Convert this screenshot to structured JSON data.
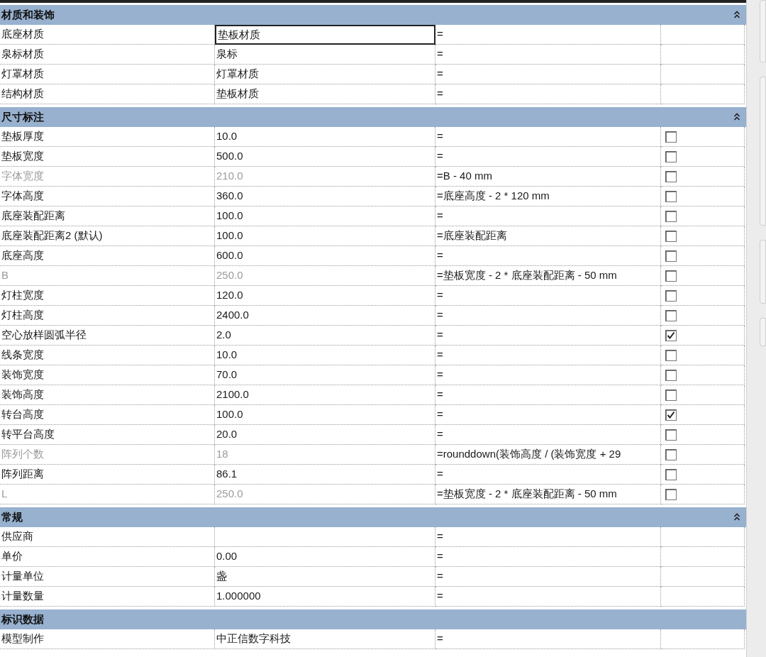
{
  "sections": [
    {
      "title": "材质和装饰",
      "expanded": true,
      "rows": [
        {
          "name": "底座材质",
          "value": "垫板材质",
          "formula": "=",
          "selected": true
        },
        {
          "name": "泉标材质",
          "value": "泉标",
          "formula": "=",
          "selected": false
        },
        {
          "name": "灯罩材质",
          "value": "灯罩材质",
          "formula": "=",
          "selected": false
        },
        {
          "name": "结构材质",
          "value": "垫板材质",
          "formula": "=",
          "selected": false
        }
      ]
    },
    {
      "title": "尺寸标注",
      "expanded": true,
      "rows": [
        {
          "name": "垫板厚度",
          "value": "10.0",
          "formula": "=",
          "selected": false,
          "disabled": false,
          "locked": false
        },
        {
          "name": "垫板宽度",
          "value": "500.0",
          "formula": "=",
          "selected": false,
          "disabled": false,
          "locked": false
        },
        {
          "name": "字体宽度",
          "value": "210.0",
          "formula": "=B - 40 mm",
          "selected": false,
          "disabled": true,
          "locked": false
        },
        {
          "name": "字体高度",
          "value": "360.0",
          "formula": "=底座高度 - 2 * 120 mm",
          "selected": false,
          "disabled": false,
          "locked": false
        },
        {
          "name": "底座装配距离",
          "value": "100.0",
          "formula": "=",
          "selected": false,
          "disabled": false,
          "locked": false
        },
        {
          "name": "底座装配距离2 (默认)",
          "value": "100.0",
          "formula": "=底座装配距离",
          "selected": false,
          "disabled": false,
          "locked": false
        },
        {
          "name": "底座高度",
          "value": "600.0",
          "formula": "=",
          "selected": false,
          "disabled": false,
          "locked": false
        },
        {
          "name": "B",
          "value": "250.0",
          "formula": "=垫板宽度 - 2 * 底座装配距离 - 50 mm",
          "selected": false,
          "disabled": true,
          "locked": false
        },
        {
          "name": "灯柱宽度",
          "value": "120.0",
          "formula": "=",
          "selected": false,
          "disabled": false,
          "locked": false
        },
        {
          "name": "灯柱高度",
          "value": "2400.0",
          "formula": "=",
          "selected": false,
          "disabled": false,
          "locked": false
        },
        {
          "name": "空心放样圆弧半径",
          "value": "2.0",
          "formula": "=",
          "selected": false,
          "disabled": false,
          "locked": true
        },
        {
          "name": "线条宽度",
          "value": "10.0",
          "formula": "=",
          "selected": false,
          "disabled": false,
          "locked": false
        },
        {
          "name": "装饰宽度",
          "value": "70.0",
          "formula": "=",
          "selected": false,
          "disabled": false,
          "locked": false
        },
        {
          "name": "装饰高度",
          "value": "2100.0",
          "formula": "=",
          "selected": false,
          "disabled": false,
          "locked": false
        },
        {
          "name": "转台高度",
          "value": "100.0",
          "formula": "=",
          "selected": false,
          "disabled": false,
          "locked": true
        },
        {
          "name": "转平台高度",
          "value": "20.0",
          "formula": "=",
          "selected": false,
          "disabled": false,
          "locked": false
        },
        {
          "name": "阵列个数",
          "value": "18",
          "formula": "=rounddown(装饰高度 / (装饰宽度 + 29",
          "selected": false,
          "disabled": true,
          "locked": false
        },
        {
          "name": "阵列距离",
          "value": "86.1",
          "formula": "=",
          "selected": false,
          "disabled": false,
          "locked": false
        },
        {
          "name": "L",
          "value": "250.0",
          "formula": "=垫板宽度 - 2 * 底座装配距离 - 50 mm",
          "selected": false,
          "disabled": true,
          "locked": false
        }
      ]
    },
    {
      "title": "常规",
      "expanded": true,
      "rows": [
        {
          "name": "供应商",
          "formula": "=",
          "selected": false
        },
        {
          "name": "单价",
          "value": "0.00",
          "formula": "=",
          "selected": false
        },
        {
          "name": "计量单位",
          "value": "盏",
          "formula": "=",
          "selected": false
        },
        {
          "name": "计量数量",
          "value": "1.000000",
          "formula": "=",
          "selected": false
        }
      ]
    },
    {
      "title": "标识数据",
      "rows": [
        {
          "name": "模型制作",
          "value": "中正信数字科技",
          "formula": "=",
          "selected": false
        }
      ]
    }
  ]
}
